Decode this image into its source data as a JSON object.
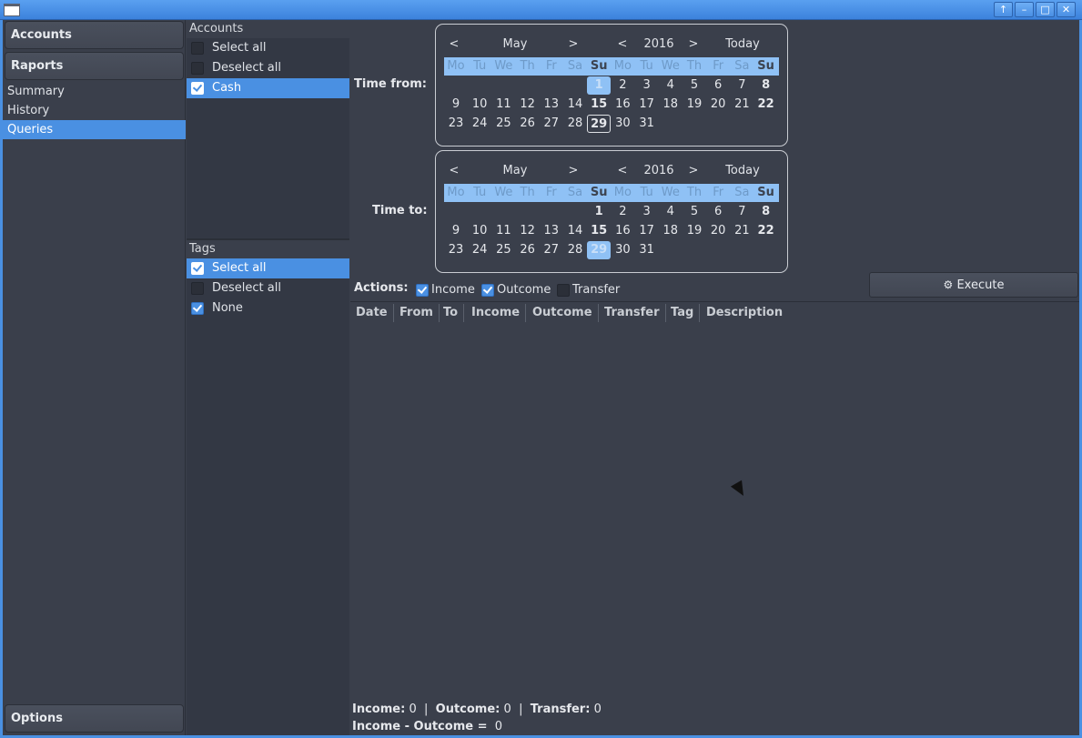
{
  "window": {
    "buttons": [
      "↑",
      "–",
      "□",
      "✕"
    ]
  },
  "nav": {
    "accounts": "Accounts",
    "raports": "Raports",
    "items": [
      "Summary",
      "History",
      "Queries"
    ],
    "options": "Options"
  },
  "accounts_panel": {
    "title": "Accounts",
    "rows": [
      {
        "label": "Select all",
        "checked": false
      },
      {
        "label": "Deselect all",
        "checked": false
      },
      {
        "label": "Cash",
        "checked": true
      }
    ]
  },
  "tags_panel": {
    "title": "Tags",
    "rows": [
      {
        "label": "Select all",
        "checked": true
      },
      {
        "label": "Deselect all",
        "checked": false
      },
      {
        "label": "None",
        "checked": true
      }
    ]
  },
  "time_from": {
    "label": "Time from:",
    "prev_month": "<",
    "month": "May",
    "next_month": ">",
    "prev_year": "<",
    "year": "2016",
    "next_year": ">",
    "today": "Today",
    "weekdays": [
      "Mo",
      "Tu",
      "We",
      "Th",
      "Fr",
      "Sa",
      "Su",
      "Mo",
      "Tu",
      "We",
      "Th",
      "Fr",
      "Sa",
      "Su"
    ]
  },
  "time_to": {
    "label": "Time to:",
    "prev_month": "<",
    "month": "May",
    "next_month": ">",
    "prev_year": "<",
    "year": "2016",
    "next_year": ">",
    "today": "Today",
    "weekdays": [
      "Mo",
      "Tu",
      "We",
      "Th",
      "Fr",
      "Sa",
      "Su",
      "Mo",
      "Tu",
      "We",
      "Th",
      "Fr",
      "Sa",
      "Su"
    ]
  },
  "calendar_rows": [
    [
      "",
      "",
      "",
      "",
      "",
      "",
      "1",
      "2",
      "3",
      "4",
      "5",
      "6",
      "7",
      "8"
    ],
    [
      "9",
      "10",
      "11",
      "12",
      "13",
      "14",
      "15",
      "16",
      "17",
      "18",
      "19",
      "20",
      "21",
      "22"
    ],
    [
      "23",
      "24",
      "25",
      "26",
      "27",
      "28",
      "29",
      "30",
      "31",
      "",
      "",
      "",
      "",
      ""
    ]
  ],
  "actions": {
    "label": "Actions:",
    "income": "Income",
    "outcome": "Outcome",
    "transfer": "Transfer",
    "execute": "Execute"
  },
  "table": {
    "columns": [
      "Date",
      "From",
      "To",
      "Income",
      "Outcome",
      "Transfer",
      "Tag",
      "Description"
    ]
  },
  "summary": {
    "income_label": "Income:",
    "income_value": "0",
    "outcome_label": "Outcome:",
    "outcome_value": "0",
    "transfer_label": "Transfer:",
    "transfer_value": "0",
    "diff_label": "Income - Outcome =",
    "diff_value": "0",
    "sep": "|"
  }
}
